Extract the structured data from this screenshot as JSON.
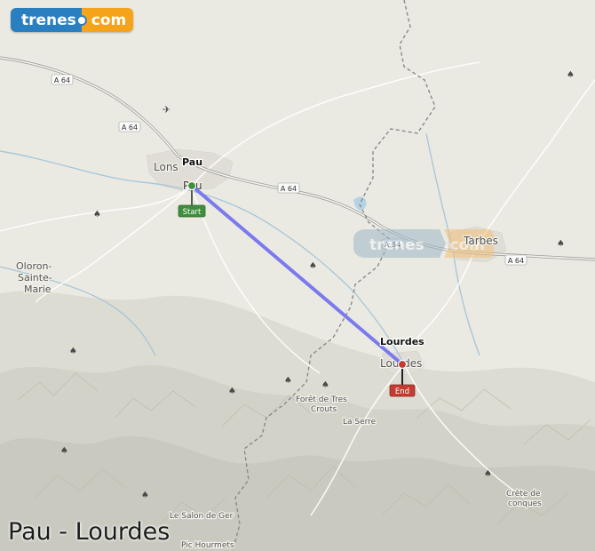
{
  "logo": {
    "part1": "trenes",
    "part2": "com"
  },
  "title": "Pau - Lourdes",
  "route": {
    "origin": {
      "name": "Pau",
      "marker_label": "Start"
    },
    "destination": {
      "name": "Lourdes",
      "marker_label": "End"
    }
  },
  "places": {
    "lons": "Lons",
    "pau": "Pau",
    "oloron": [
      "Oloron-",
      "Sainte-",
      "Marie"
    ],
    "tarbes": "Tarbes",
    "lourdes": "Lourdes",
    "foret": [
      "Forêt de Tres",
      "Crouts"
    ],
    "la_serre": "La Serre",
    "crete": [
      "Crête de",
      "conques"
    ],
    "salon": "Le Salon de Ger",
    "pic": "Pic Hourmets"
  },
  "roads": {
    "a64": "A 64"
  },
  "watermark": {
    "part1": "trenes",
    "part2": ".com"
  },
  "colors": {
    "route_line": "#7a7aee",
    "start_marker": "#3e8e3e",
    "end_marker": "#c53b30",
    "logo_blue": "#2a7fc0",
    "logo_orange": "#f5a31a"
  }
}
